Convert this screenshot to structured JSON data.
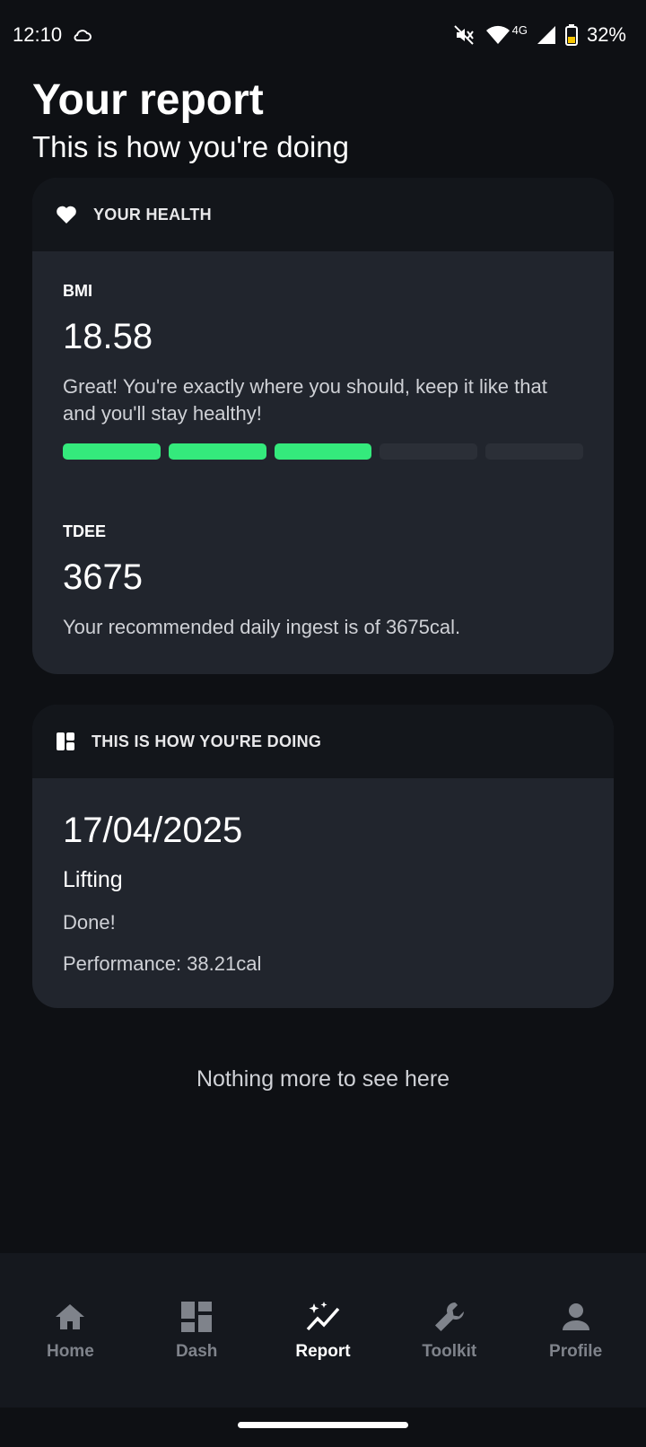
{
  "status_bar": {
    "time": "12:10",
    "network": "4G",
    "battery": "32%",
    "icons": [
      "cloud-icon",
      "mute-icon",
      "wifi-icon",
      "signal-icon",
      "battery-icon"
    ]
  },
  "header": {
    "title": "Your report",
    "subtitle": "This is how you're doing"
  },
  "health_card": {
    "heading": "YOUR HEALTH",
    "icon": "heart-icon",
    "bmi": {
      "label": "BMI",
      "value": "18.58",
      "description": "Great! You're exactly where you should, keep it like that and you'll stay healthy!",
      "level_filled": 3,
      "level_total": 5,
      "accent": "#34ea7c"
    },
    "tdee": {
      "label": "TDEE",
      "value": "3675",
      "description": "Your recommended daily ingest is of 3675cal."
    }
  },
  "progress_card": {
    "heading": "THIS IS HOW YOU'RE DOING",
    "icon": "dashboard-icon",
    "entry": {
      "date": "17/04/2025",
      "activity": "Lifting",
      "status": "Done!",
      "performance": "Performance: 38.21cal"
    }
  },
  "end_note": "Nothing more to see here",
  "nav": {
    "items": [
      {
        "label": "Home",
        "icon": "home-icon",
        "active": false
      },
      {
        "label": "Dash",
        "icon": "dashboard-icon",
        "active": false
      },
      {
        "label": "Report",
        "icon": "sparkle-chart-icon",
        "active": true
      },
      {
        "label": "Toolkit",
        "icon": "wrench-icon",
        "active": false
      },
      {
        "label": "Profile",
        "icon": "person-icon",
        "active": false
      }
    ]
  },
  "colors": {
    "background": "#0e1014",
    "card": "#21252d",
    "card_header": "#13161b",
    "accent_green": "#34ea7c",
    "nav_inactive": "#7f838b"
  }
}
